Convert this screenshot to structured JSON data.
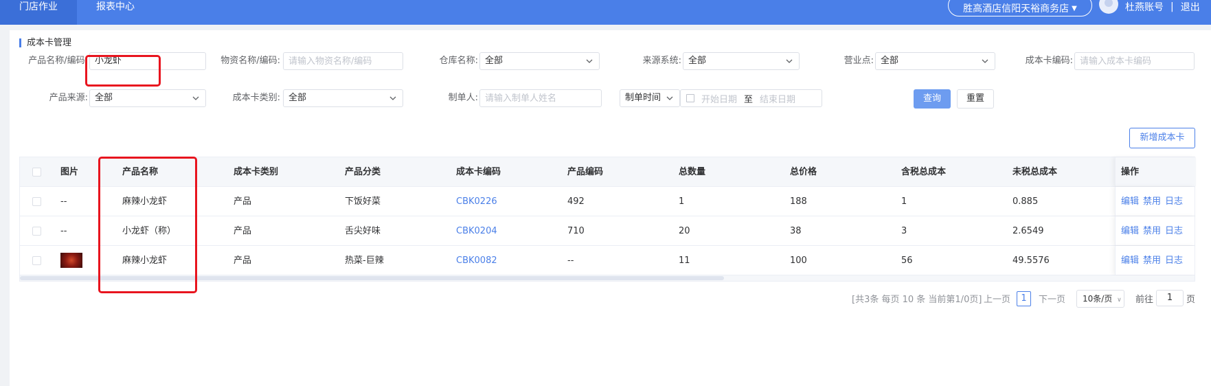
{
  "topnav": {
    "items": [
      "门店作业",
      "报表中心"
    ],
    "store": "胜高酒店信阳天裕商务店",
    "user": "杜燕账号",
    "separator": "|",
    "logout": "退出"
  },
  "section": {
    "title": "成本卡管理"
  },
  "filters": {
    "product_name_label": "产品名称/编码:",
    "product_name_value": "小龙虾",
    "material_label": "物资名称/编码:",
    "material_placeholder": "请输入物资名称/编码",
    "warehouse_label": "仓库名称:",
    "warehouse_value": "全部",
    "source_system_label": "来源系统:",
    "source_system_value": "全部",
    "business_point_label": "营业点:",
    "business_point_value": "全部",
    "card_code_label": "成本卡编码:",
    "card_code_placeholder": "请输入成本卡编码",
    "product_source_label": "产品来源:",
    "product_source_value": "全部",
    "card_type_label": "成本卡类别:",
    "card_type_value": "全部",
    "creator_label": "制单人:",
    "creator_placeholder": "请输入制单人姓名",
    "time_type_value": "制单时间",
    "start_date_placeholder": "开始日期",
    "range_sep": "至",
    "end_date_placeholder": "结束日期",
    "query_button": "查询",
    "reset_button": "重置"
  },
  "actions": {
    "add_button": "新增成本卡"
  },
  "table": {
    "headers": [
      "图片",
      "产品名称",
      "成本卡类别",
      "产品分类",
      "成本卡编码",
      "产品编码",
      "总数量",
      "总价格",
      "含税总成本",
      "未税总成本",
      "操作"
    ],
    "rows": [
      {
        "image": "--",
        "name": "麻辣小龙虾",
        "type": "产品",
        "category": "下饭好菜",
        "card_code": "CBK0226",
        "product_code": "492",
        "qty": "1",
        "price": "188",
        "tax_cost": "1",
        "net_cost": "0.885"
      },
      {
        "image": "--",
        "name": "小龙虾（称）",
        "type": "产品",
        "category": "舌尖好味",
        "card_code": "CBK0204",
        "product_code": "710",
        "qty": "20",
        "price": "38",
        "tax_cost": "3",
        "net_cost": "2.6549"
      },
      {
        "image": "",
        "name": "麻辣小龙虾",
        "type": "产品",
        "category": "热菜-巨辣",
        "card_code": "CBK0082",
        "product_code": "--",
        "qty": "11",
        "price": "100",
        "tax_cost": "56",
        "net_cost": "49.5576"
      }
    ],
    "ops": {
      "edit": "编辑",
      "disable": "禁用",
      "log": "日志"
    }
  },
  "pagination": {
    "summary": "[共3条 每页 10 条 当前第1/0页]",
    "prev": "上一页",
    "current": "1",
    "next": "下一页",
    "page_size": "10条/页",
    "goto_label": "前往",
    "goto_value": "1",
    "page_suffix": "页"
  },
  "colors": {
    "primary": "#4a7fe8",
    "annotation": "#e8141e"
  }
}
